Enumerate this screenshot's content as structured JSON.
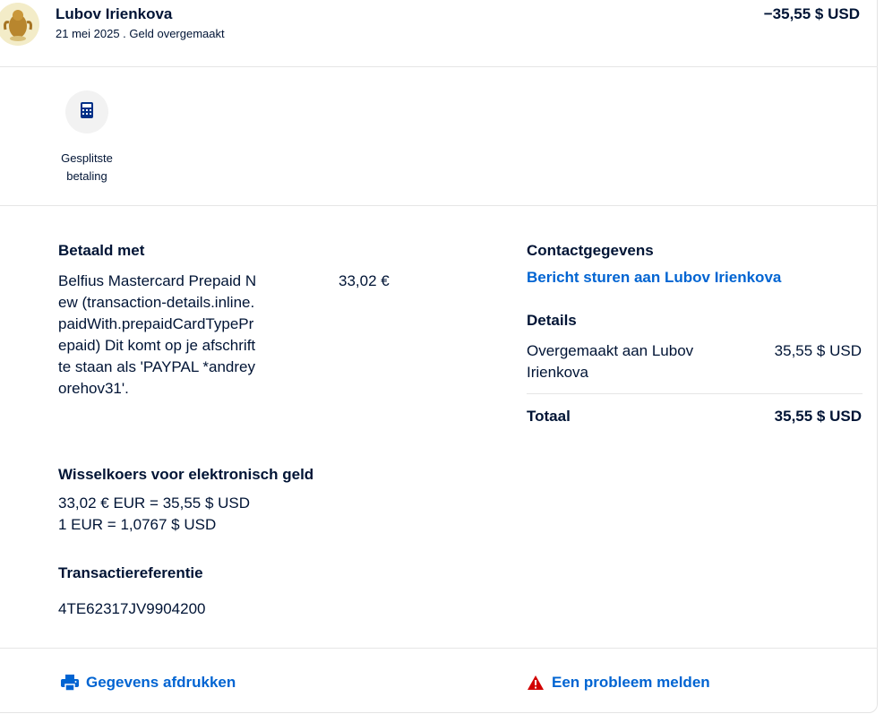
{
  "header": {
    "name": "Lubov Irienkova",
    "subtitle": "21 mei 2025 . Geld overgemaakt",
    "amount": "−35,55 $ USD"
  },
  "actions": {
    "split_payment_label": "Gesplitste betaling"
  },
  "paid_with": {
    "title": "Betaald met",
    "description": "Belfius Mastercard Prepaid New (transaction-details.inline.paidWith.prepaidCardTypePrepaid) Dit komt op je afschrift te staan als 'PAYPAL *andreyorehov31'.",
    "amount": "33,02 €"
  },
  "exchange": {
    "title": "Wisselkoers voor elektronisch geld",
    "line1": "33,02 € EUR = 35,55 $ USD",
    "line2": "1 EUR = 1,0767 $ USD"
  },
  "reference": {
    "title": "Transactiereferentie",
    "value": "4TE62317JV9904200"
  },
  "contact": {
    "title": "Contactgegevens",
    "link": "Bericht sturen aan Lubov Irienkova"
  },
  "details": {
    "title": "Details",
    "row_label": "Overgemaakt aan Lubov Irienkova",
    "row_value": "35,55 $ USD",
    "total_label": "Totaal",
    "total_value": "35,55 $ USD"
  },
  "footer": {
    "print_label": "Gegevens afdrukken",
    "report_label": "Een probleem melden"
  },
  "icons": {
    "calculator": "calculator-icon",
    "printer": "printer-icon",
    "warning": "warning-icon"
  },
  "colors": {
    "link": "#0064d2",
    "text": "#001435",
    "warning": "#d20000"
  }
}
